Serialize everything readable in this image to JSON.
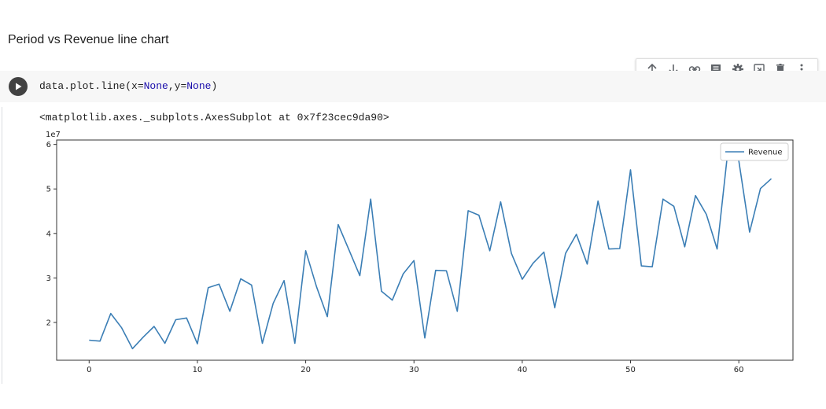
{
  "heading": "Period vs Revenue line chart",
  "toolbar": {
    "buttons": [
      {
        "icon": "arrow-up-icon"
      },
      {
        "icon": "arrow-down-icon"
      },
      {
        "icon": "link-icon"
      },
      {
        "icon": "comment-icon"
      },
      {
        "icon": "gear-icon"
      },
      {
        "icon": "mirror-cell-icon"
      },
      {
        "icon": "trash-icon"
      },
      {
        "icon": "more-vert-icon"
      }
    ]
  },
  "code": {
    "prefix": "data.plot.line(x=",
    "kw1": "None",
    "mid": ",y=",
    "kw2": "None",
    "suffix": ")"
  },
  "output_text": "<matplotlib.axes._subplots.AxesSubplot at 0x7f23cec9da90>",
  "colors": {
    "line": "#3b7eb5",
    "keyword": "#1a0dab",
    "run_button": "#424242"
  },
  "chart_data": {
    "type": "line",
    "title": "",
    "xlabel": "",
    "ylabel": "",
    "y_offset_label": "1e7",
    "xlim": [
      -3,
      65
    ],
    "ylim": [
      1.15,
      6.1
    ],
    "x_ticks": [
      0,
      10,
      20,
      30,
      40,
      50,
      60
    ],
    "y_ticks": [
      2,
      3,
      4,
      5,
      6
    ],
    "grid": false,
    "legend_position": "top-right",
    "series": [
      {
        "name": "Revenue",
        "x": [
          0,
          1,
          2,
          3,
          4,
          5,
          6,
          7,
          8,
          9,
          10,
          11,
          12,
          13,
          14,
          15,
          16,
          17,
          18,
          19,
          20,
          21,
          22,
          23,
          24,
          25,
          26,
          27,
          28,
          29,
          30,
          31,
          32,
          33,
          34,
          35,
          36,
          37,
          38,
          39,
          40,
          41,
          42,
          43,
          44,
          45,
          46,
          47,
          48,
          49,
          50,
          51,
          52,
          53,
          54,
          55,
          56,
          57,
          58,
          59,
          60,
          61,
          62,
          63
        ],
        "values": [
          1.6,
          1.58,
          2.2,
          1.88,
          1.41,
          1.67,
          1.91,
          1.53,
          2.06,
          2.1,
          1.52,
          2.78,
          2.86,
          2.25,
          2.98,
          2.84,
          1.53,
          2.43,
          2.94,
          1.53,
          3.61,
          2.8,
          2.13,
          4.2,
          3.63,
          3.05,
          4.77,
          2.7,
          2.5,
          3.09,
          3.39,
          1.65,
          3.17,
          3.16,
          2.25,
          4.51,
          4.41,
          3.61,
          4.71,
          3.55,
          2.97,
          3.33,
          3.58,
          2.33,
          3.55,
          3.98,
          3.31,
          4.73,
          3.65,
          3.66,
          5.43,
          3.27,
          3.25,
          4.77,
          4.61,
          3.7,
          4.85,
          4.43,
          3.65,
          5.88,
          5.63,
          4.03,
          5.01,
          5.23
        ]
      }
    ]
  }
}
